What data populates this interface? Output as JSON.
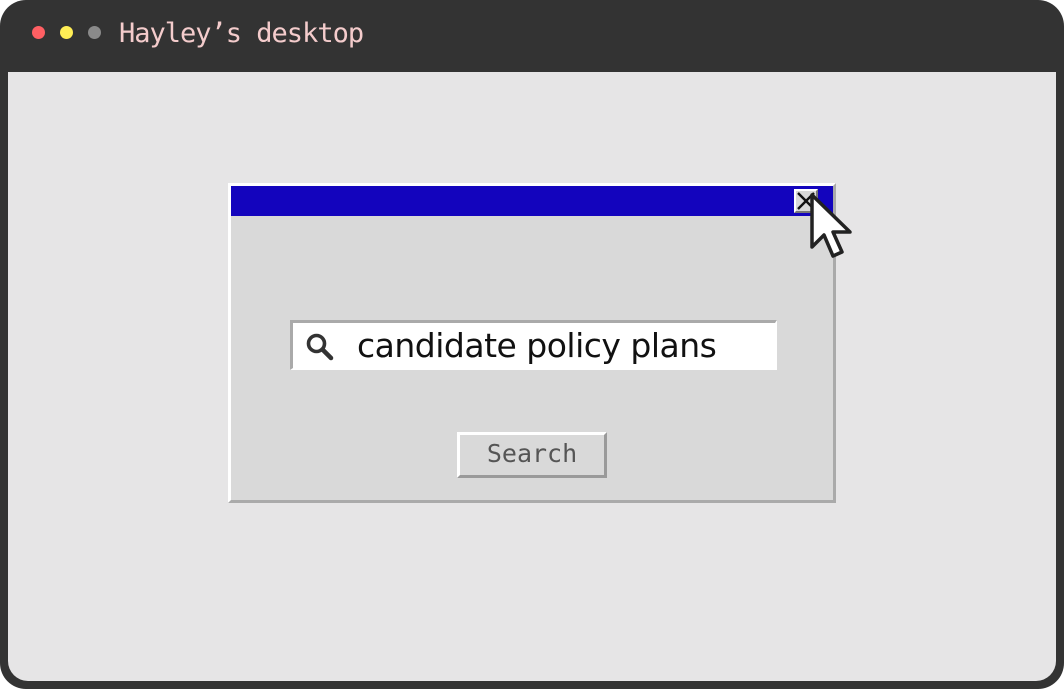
{
  "window": {
    "title": "Hayley’s desktop",
    "controls": [
      "close-dot",
      "minimize-dot",
      "zoom-dot"
    ]
  },
  "dialog": {
    "titlebar_color": "#1304bd",
    "close_icon": "close-icon",
    "search": {
      "icon": "search-icon",
      "value": "candidate policy plans"
    },
    "button_label": "Search"
  },
  "colors": {
    "frame": "#333333",
    "desktop": "#e6e5e6",
    "dialog_bg": "#d9d9d9",
    "title_text": "#f4cccc",
    "dot_red": "#ff5f63",
    "dot_yellow": "#ffee55",
    "dot_gray": "#8a8a8a"
  },
  "cursor": "arrow-cursor-icon"
}
